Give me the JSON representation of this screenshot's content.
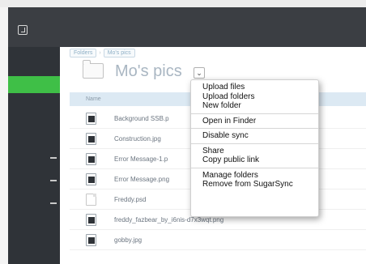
{
  "breadcrumb": {
    "items": [
      "Folders",
      "Mo's pics"
    ]
  },
  "folder": {
    "title": "Mo's pics"
  },
  "dropdown": {
    "glyph": "⌄"
  },
  "table": {
    "column_name": "Name"
  },
  "files": [
    {
      "name": "Background SSB.p",
      "kind": "image"
    },
    {
      "name": "Construction.jpg",
      "kind": "image"
    },
    {
      "name": "Error Message-1.p",
      "kind": "image"
    },
    {
      "name": "Error Message.png",
      "kind": "image"
    },
    {
      "name": "Freddy.psd",
      "kind": "document"
    },
    {
      "name": "freddy_fazbear_by_i6nis-d7x3wqt.png",
      "kind": "image"
    },
    {
      "name": "gobby.jpg",
      "kind": "image"
    }
  ],
  "context_menu": {
    "groups": [
      [
        "Upload files",
        "Upload folders",
        "New folder"
      ],
      [
        "Open in Finder"
      ],
      [
        "Disable sync"
      ],
      [
        "Share",
        "Copy public link"
      ],
      [
        "Manage folders",
        "Remove from SugarSync"
      ]
    ]
  },
  "colors": {
    "sidebar_accent": "#3fbf47",
    "topbar": "#3b3e43",
    "sidebar": "#2f3338",
    "header_row": "#dce9f3"
  }
}
